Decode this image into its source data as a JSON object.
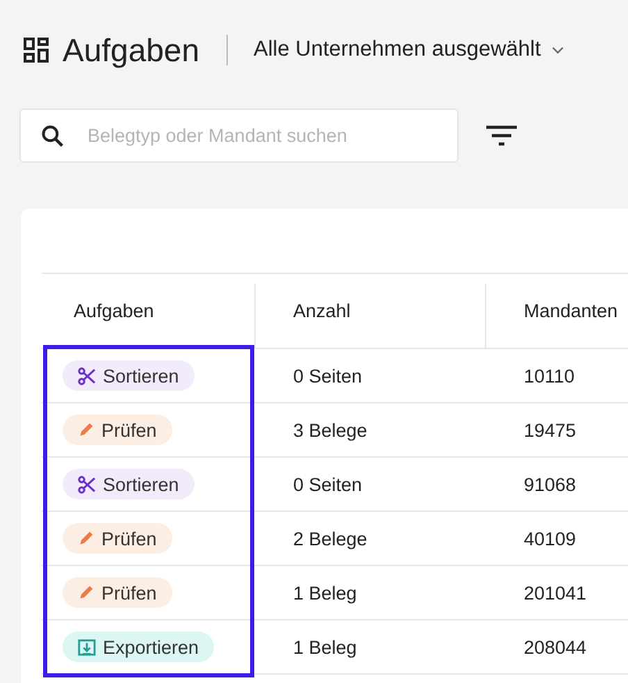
{
  "header": {
    "title": "Aufgaben",
    "company_selector": "Alle Unternehmen ausgewählt"
  },
  "search": {
    "placeholder": "Belegtyp oder Mandant suchen"
  },
  "table": {
    "highlight_first_column": true,
    "columns": [
      "Aufgaben",
      "Anzahl",
      "Mandanten"
    ],
    "rows": [
      {
        "task": {
          "kind": "sort",
          "label": "Sortieren"
        },
        "count": "0 Seiten",
        "client": "10110"
      },
      {
        "task": {
          "kind": "check",
          "label": "Prüfen"
        },
        "count": "3 Belege",
        "client": "19475"
      },
      {
        "task": {
          "kind": "sort",
          "label": "Sortieren"
        },
        "count": "0 Seiten",
        "client": "91068"
      },
      {
        "task": {
          "kind": "check",
          "label": "Prüfen"
        },
        "count": "2 Belege",
        "client": "40109"
      },
      {
        "task": {
          "kind": "check",
          "label": "Prüfen"
        },
        "count": "1 Beleg",
        "client": "201041"
      },
      {
        "task": {
          "kind": "export",
          "label": "Exportieren"
        },
        "count": "1 Beleg",
        "client": "208044"
      }
    ]
  }
}
